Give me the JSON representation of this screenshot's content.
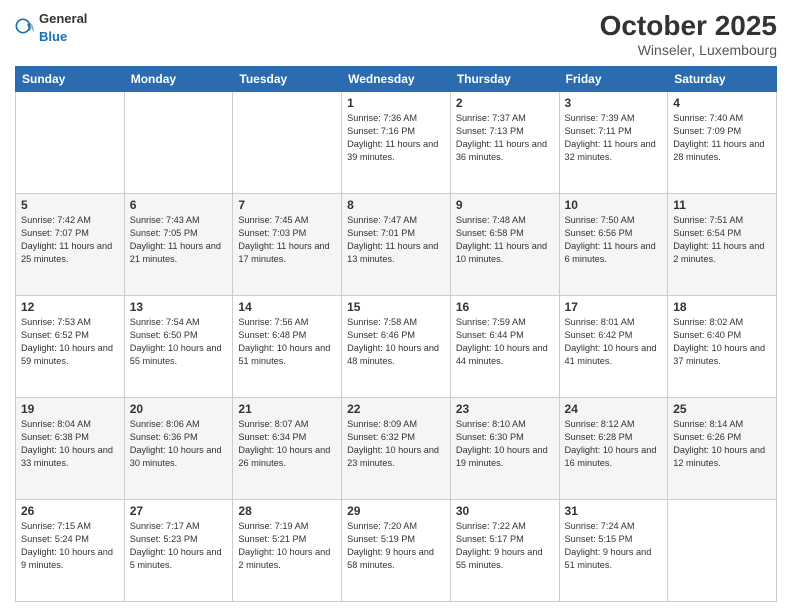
{
  "header": {
    "logo_general": "General",
    "logo_blue": "Blue",
    "month": "October 2025",
    "location": "Winseler, Luxembourg"
  },
  "days_of_week": [
    "Sunday",
    "Monday",
    "Tuesday",
    "Wednesday",
    "Thursday",
    "Friday",
    "Saturday"
  ],
  "weeks": [
    [
      {
        "day": "",
        "info": ""
      },
      {
        "day": "",
        "info": ""
      },
      {
        "day": "",
        "info": ""
      },
      {
        "day": "1",
        "info": "Sunrise: 7:36 AM\nSunset: 7:16 PM\nDaylight: 11 hours and 39 minutes."
      },
      {
        "day": "2",
        "info": "Sunrise: 7:37 AM\nSunset: 7:13 PM\nDaylight: 11 hours and 36 minutes."
      },
      {
        "day": "3",
        "info": "Sunrise: 7:39 AM\nSunset: 7:11 PM\nDaylight: 11 hours and 32 minutes."
      },
      {
        "day": "4",
        "info": "Sunrise: 7:40 AM\nSunset: 7:09 PM\nDaylight: 11 hours and 28 minutes."
      }
    ],
    [
      {
        "day": "5",
        "info": "Sunrise: 7:42 AM\nSunset: 7:07 PM\nDaylight: 11 hours and 25 minutes."
      },
      {
        "day": "6",
        "info": "Sunrise: 7:43 AM\nSunset: 7:05 PM\nDaylight: 11 hours and 21 minutes."
      },
      {
        "day": "7",
        "info": "Sunrise: 7:45 AM\nSunset: 7:03 PM\nDaylight: 11 hours and 17 minutes."
      },
      {
        "day": "8",
        "info": "Sunrise: 7:47 AM\nSunset: 7:01 PM\nDaylight: 11 hours and 13 minutes."
      },
      {
        "day": "9",
        "info": "Sunrise: 7:48 AM\nSunset: 6:58 PM\nDaylight: 11 hours and 10 minutes."
      },
      {
        "day": "10",
        "info": "Sunrise: 7:50 AM\nSunset: 6:56 PM\nDaylight: 11 hours and 6 minutes."
      },
      {
        "day": "11",
        "info": "Sunrise: 7:51 AM\nSunset: 6:54 PM\nDaylight: 11 hours and 2 minutes."
      }
    ],
    [
      {
        "day": "12",
        "info": "Sunrise: 7:53 AM\nSunset: 6:52 PM\nDaylight: 10 hours and 59 minutes."
      },
      {
        "day": "13",
        "info": "Sunrise: 7:54 AM\nSunset: 6:50 PM\nDaylight: 10 hours and 55 minutes."
      },
      {
        "day": "14",
        "info": "Sunrise: 7:56 AM\nSunset: 6:48 PM\nDaylight: 10 hours and 51 minutes."
      },
      {
        "day": "15",
        "info": "Sunrise: 7:58 AM\nSunset: 6:46 PM\nDaylight: 10 hours and 48 minutes."
      },
      {
        "day": "16",
        "info": "Sunrise: 7:59 AM\nSunset: 6:44 PM\nDaylight: 10 hours and 44 minutes."
      },
      {
        "day": "17",
        "info": "Sunrise: 8:01 AM\nSunset: 6:42 PM\nDaylight: 10 hours and 41 minutes."
      },
      {
        "day": "18",
        "info": "Sunrise: 8:02 AM\nSunset: 6:40 PM\nDaylight: 10 hours and 37 minutes."
      }
    ],
    [
      {
        "day": "19",
        "info": "Sunrise: 8:04 AM\nSunset: 6:38 PM\nDaylight: 10 hours and 33 minutes."
      },
      {
        "day": "20",
        "info": "Sunrise: 8:06 AM\nSunset: 6:36 PM\nDaylight: 10 hours and 30 minutes."
      },
      {
        "day": "21",
        "info": "Sunrise: 8:07 AM\nSunset: 6:34 PM\nDaylight: 10 hours and 26 minutes."
      },
      {
        "day": "22",
        "info": "Sunrise: 8:09 AM\nSunset: 6:32 PM\nDaylight: 10 hours and 23 minutes."
      },
      {
        "day": "23",
        "info": "Sunrise: 8:10 AM\nSunset: 6:30 PM\nDaylight: 10 hours and 19 minutes."
      },
      {
        "day": "24",
        "info": "Sunrise: 8:12 AM\nSunset: 6:28 PM\nDaylight: 10 hours and 16 minutes."
      },
      {
        "day": "25",
        "info": "Sunrise: 8:14 AM\nSunset: 6:26 PM\nDaylight: 10 hours and 12 minutes."
      }
    ],
    [
      {
        "day": "26",
        "info": "Sunrise: 7:15 AM\nSunset: 5:24 PM\nDaylight: 10 hours and 9 minutes."
      },
      {
        "day": "27",
        "info": "Sunrise: 7:17 AM\nSunset: 5:23 PM\nDaylight: 10 hours and 5 minutes."
      },
      {
        "day": "28",
        "info": "Sunrise: 7:19 AM\nSunset: 5:21 PM\nDaylight: 10 hours and 2 minutes."
      },
      {
        "day": "29",
        "info": "Sunrise: 7:20 AM\nSunset: 5:19 PM\nDaylight: 9 hours and 58 minutes."
      },
      {
        "day": "30",
        "info": "Sunrise: 7:22 AM\nSunset: 5:17 PM\nDaylight: 9 hours and 55 minutes."
      },
      {
        "day": "31",
        "info": "Sunrise: 7:24 AM\nSunset: 5:15 PM\nDaylight: 9 hours and 51 minutes."
      },
      {
        "day": "",
        "info": ""
      }
    ]
  ]
}
